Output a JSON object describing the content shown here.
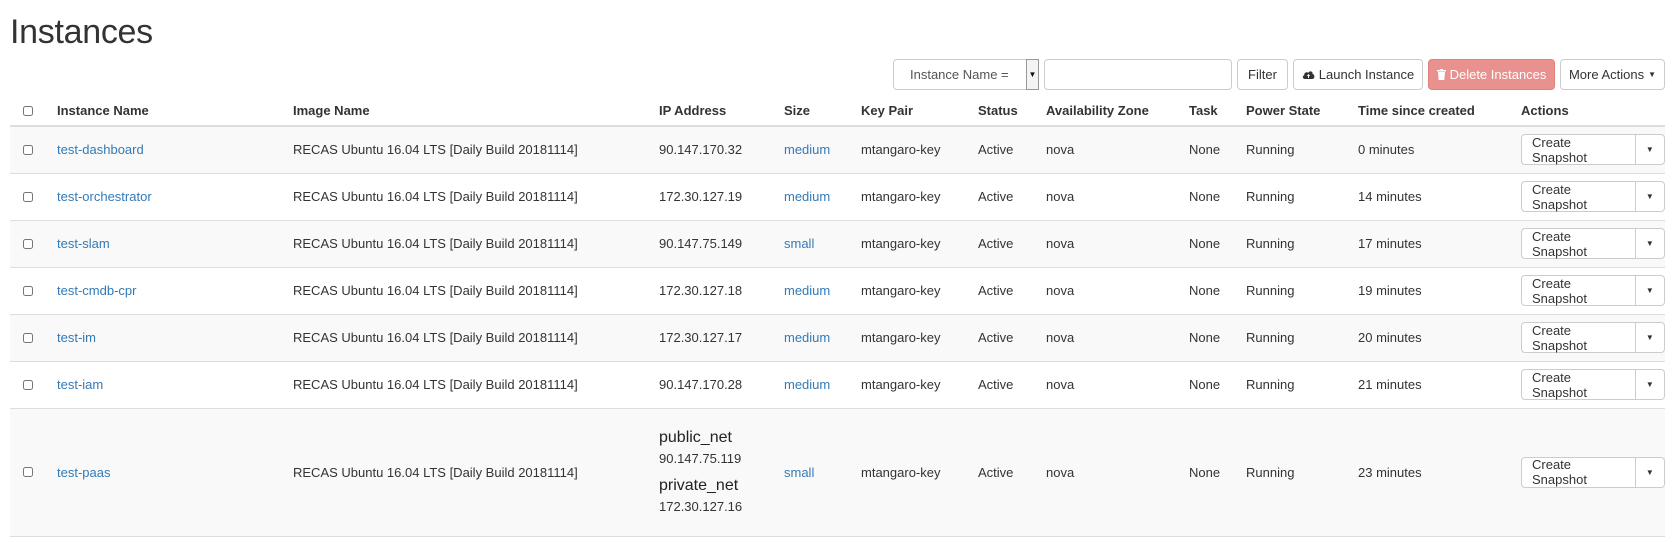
{
  "page": {
    "title": "Instances"
  },
  "toolbar": {
    "filter_field": "Instance Name =",
    "filter_value": "",
    "filter_label": "Filter",
    "launch_label": "Launch Instance",
    "delete_label": "Delete Instances",
    "more_label": "More Actions"
  },
  "colors": {
    "link": "#337ab7",
    "danger": "#e8918f",
    "border": "#dddddd"
  },
  "table": {
    "headers": {
      "name": "Instance Name",
      "image": "Image Name",
      "ip": "IP Address",
      "size": "Size",
      "keypair": "Key Pair",
      "status": "Status",
      "az": "Availability Zone",
      "task": "Task",
      "power": "Power State",
      "time": "Time since created",
      "actions": "Actions"
    },
    "rows": [
      {
        "name": "test-dashboard",
        "image": "RECAS Ubuntu 16.04 LTS [Daily Build 20181114]",
        "ip": "90.147.170.32",
        "size": "medium",
        "keypair": "mtangaro-key",
        "status": "Active",
        "az": "nova",
        "task": "None",
        "power": "Running",
        "time": "0 minutes",
        "action": "Create Snapshot"
      },
      {
        "name": "test-orchestrator",
        "image": "RECAS Ubuntu 16.04 LTS [Daily Build 20181114]",
        "ip": "172.30.127.19",
        "size": "medium",
        "keypair": "mtangaro-key",
        "status": "Active",
        "az": "nova",
        "task": "None",
        "power": "Running",
        "time": "14 minutes",
        "action": "Create Snapshot"
      },
      {
        "name": "test-slam",
        "image": "RECAS Ubuntu 16.04 LTS [Daily Build 20181114]",
        "ip": "90.147.75.149",
        "size": "small",
        "keypair": "mtangaro-key",
        "status": "Active",
        "az": "nova",
        "task": "None",
        "power": "Running",
        "time": "17 minutes",
        "action": "Create Snapshot"
      },
      {
        "name": "test-cmdb-cpr",
        "image": "RECAS Ubuntu 16.04 LTS [Daily Build 20181114]",
        "ip": "172.30.127.18",
        "size": "medium",
        "keypair": "mtangaro-key",
        "status": "Active",
        "az": "nova",
        "task": "None",
        "power": "Running",
        "time": "19 minutes",
        "action": "Create Snapshot"
      },
      {
        "name": "test-im",
        "image": "RECAS Ubuntu 16.04 LTS [Daily Build 20181114]",
        "ip": "172.30.127.17",
        "size": "medium",
        "keypair": "mtangaro-key",
        "status": "Active",
        "az": "nova",
        "task": "None",
        "power": "Running",
        "time": "20 minutes",
        "action": "Create Snapshot"
      },
      {
        "name": "test-iam",
        "image": "RECAS Ubuntu 16.04 LTS [Daily Build 20181114]",
        "ip": "90.147.170.28",
        "size": "medium",
        "keypair": "mtangaro-key",
        "status": "Active",
        "az": "nova",
        "task": "None",
        "power": "Running",
        "time": "21 minutes",
        "action": "Create Snapshot"
      },
      {
        "name": "test-paas",
        "image": "RECAS Ubuntu 16.04 LTS [Daily Build 20181114]",
        "networks": [
          {
            "name": "public_net",
            "ip": "90.147.75.119"
          },
          {
            "name": "private_net",
            "ip": "172.30.127.16"
          }
        ],
        "size": "small",
        "keypair": "mtangaro-key",
        "status": "Active",
        "az": "nova",
        "task": "None",
        "power": "Running",
        "time": "23 minutes",
        "action": "Create Snapshot"
      }
    ]
  }
}
